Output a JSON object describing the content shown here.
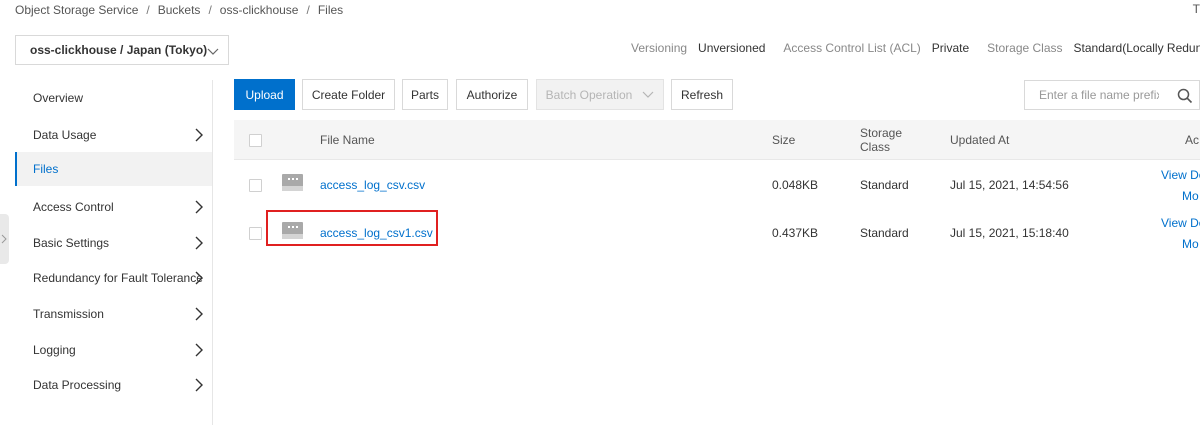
{
  "breadcrumb": [
    "Object Storage Service",
    "Buckets",
    "oss-clickhouse",
    "Files"
  ],
  "breadcrumb_separator": "/",
  "top_right_char": "T",
  "bucket_selector": {
    "value": "oss-clickhouse / Japan (Tokyo)"
  },
  "bucket_info": {
    "versioning_label": "Versioning",
    "versioning_value": "Unversioned",
    "acl_label": "Access Control List (ACL)",
    "acl_value": "Private",
    "storage_class_label": "Storage Class",
    "storage_class_value": "Standard(Locally Redundant S"
  },
  "sidebar": {
    "items": [
      {
        "label": "Overview",
        "has_arrow": false
      },
      {
        "label": "Data Usage",
        "has_arrow": true
      },
      {
        "label": "Files",
        "has_arrow": false,
        "active": true
      },
      {
        "label": "Access Control",
        "has_arrow": true
      },
      {
        "label": "Basic Settings",
        "has_arrow": true
      },
      {
        "label": "Redundancy for Fault Tolerance",
        "has_arrow": true
      },
      {
        "label": "Transmission",
        "has_arrow": true
      },
      {
        "label": "Logging",
        "has_arrow": true
      },
      {
        "label": "Data Processing",
        "has_arrow": true
      }
    ]
  },
  "toolbar": {
    "upload": "Upload",
    "create_folder": "Create Folder",
    "parts": "Parts",
    "authorize": "Authorize",
    "batch_operation": "Batch Operation",
    "refresh": "Refresh"
  },
  "search": {
    "placeholder": "Enter a file name prefix"
  },
  "table": {
    "headers": {
      "file_name": "File Name",
      "size": "Size",
      "storage_class_line1": "Storage",
      "storage_class_line2": "Class",
      "updated_at": "Updated At",
      "actions": "Ac"
    },
    "rows": [
      {
        "name": "access_log_csv.csv",
        "size": "0.048KB",
        "storage_class": "Standard",
        "updated_at": "Jul 15, 2021, 14:54:56",
        "action1": "View De",
        "action2": "Mo"
      },
      {
        "name": "access_log_csv1.csv",
        "size": "0.437KB",
        "storage_class": "Standard",
        "updated_at": "Jul 15, 2021, 15:18:40",
        "action1": "View De",
        "action2": "Mo"
      }
    ]
  },
  "colors": {
    "primary": "#0070cc",
    "highlight": "#e02020"
  },
  "icons": [
    "chevron-down-icon",
    "chevron-right-icon",
    "search-icon",
    "file-icon"
  ]
}
